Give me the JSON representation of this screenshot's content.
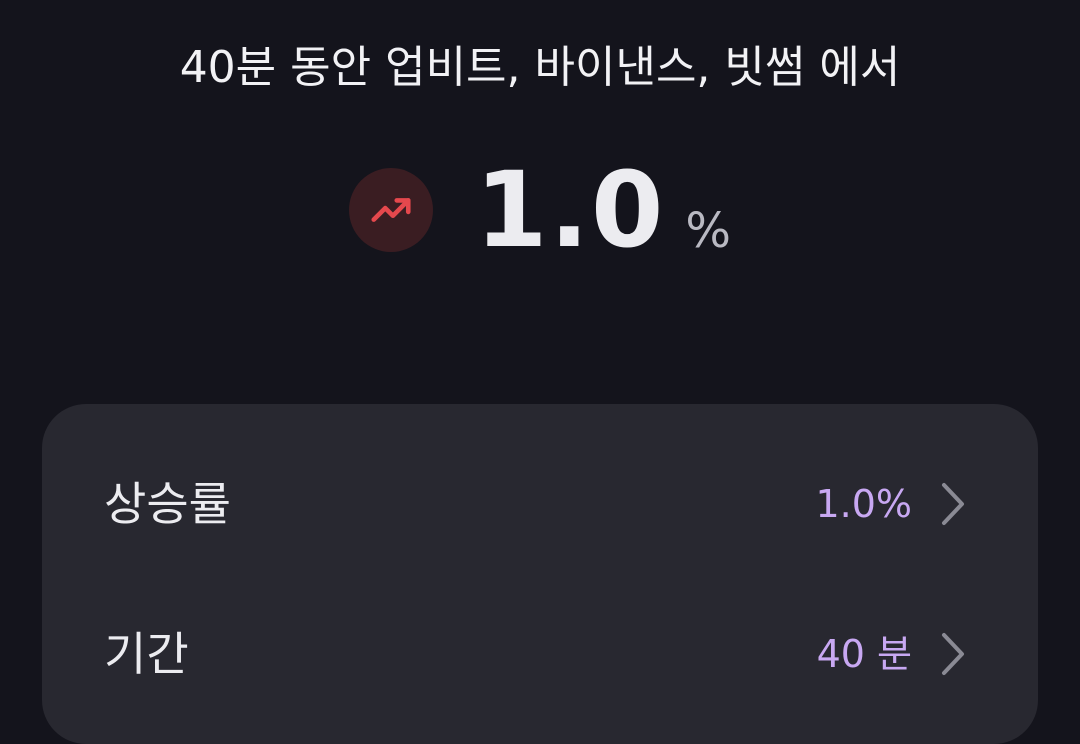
{
  "header": {
    "text": "40분 동안 업비트, 바이낸스, 빗썸 에서"
  },
  "rate_display": {
    "icon": "trending-up-icon",
    "value": "1.0",
    "unit": "%",
    "accent_color": "#e5484d"
  },
  "settings": {
    "rows": [
      {
        "label": "상승률",
        "value": "1.0%",
        "icon": "chevron-right-icon"
      },
      {
        "label": "기간",
        "value": "40 분",
        "icon": "chevron-right-icon"
      }
    ],
    "value_color": "#c8a8f2"
  }
}
